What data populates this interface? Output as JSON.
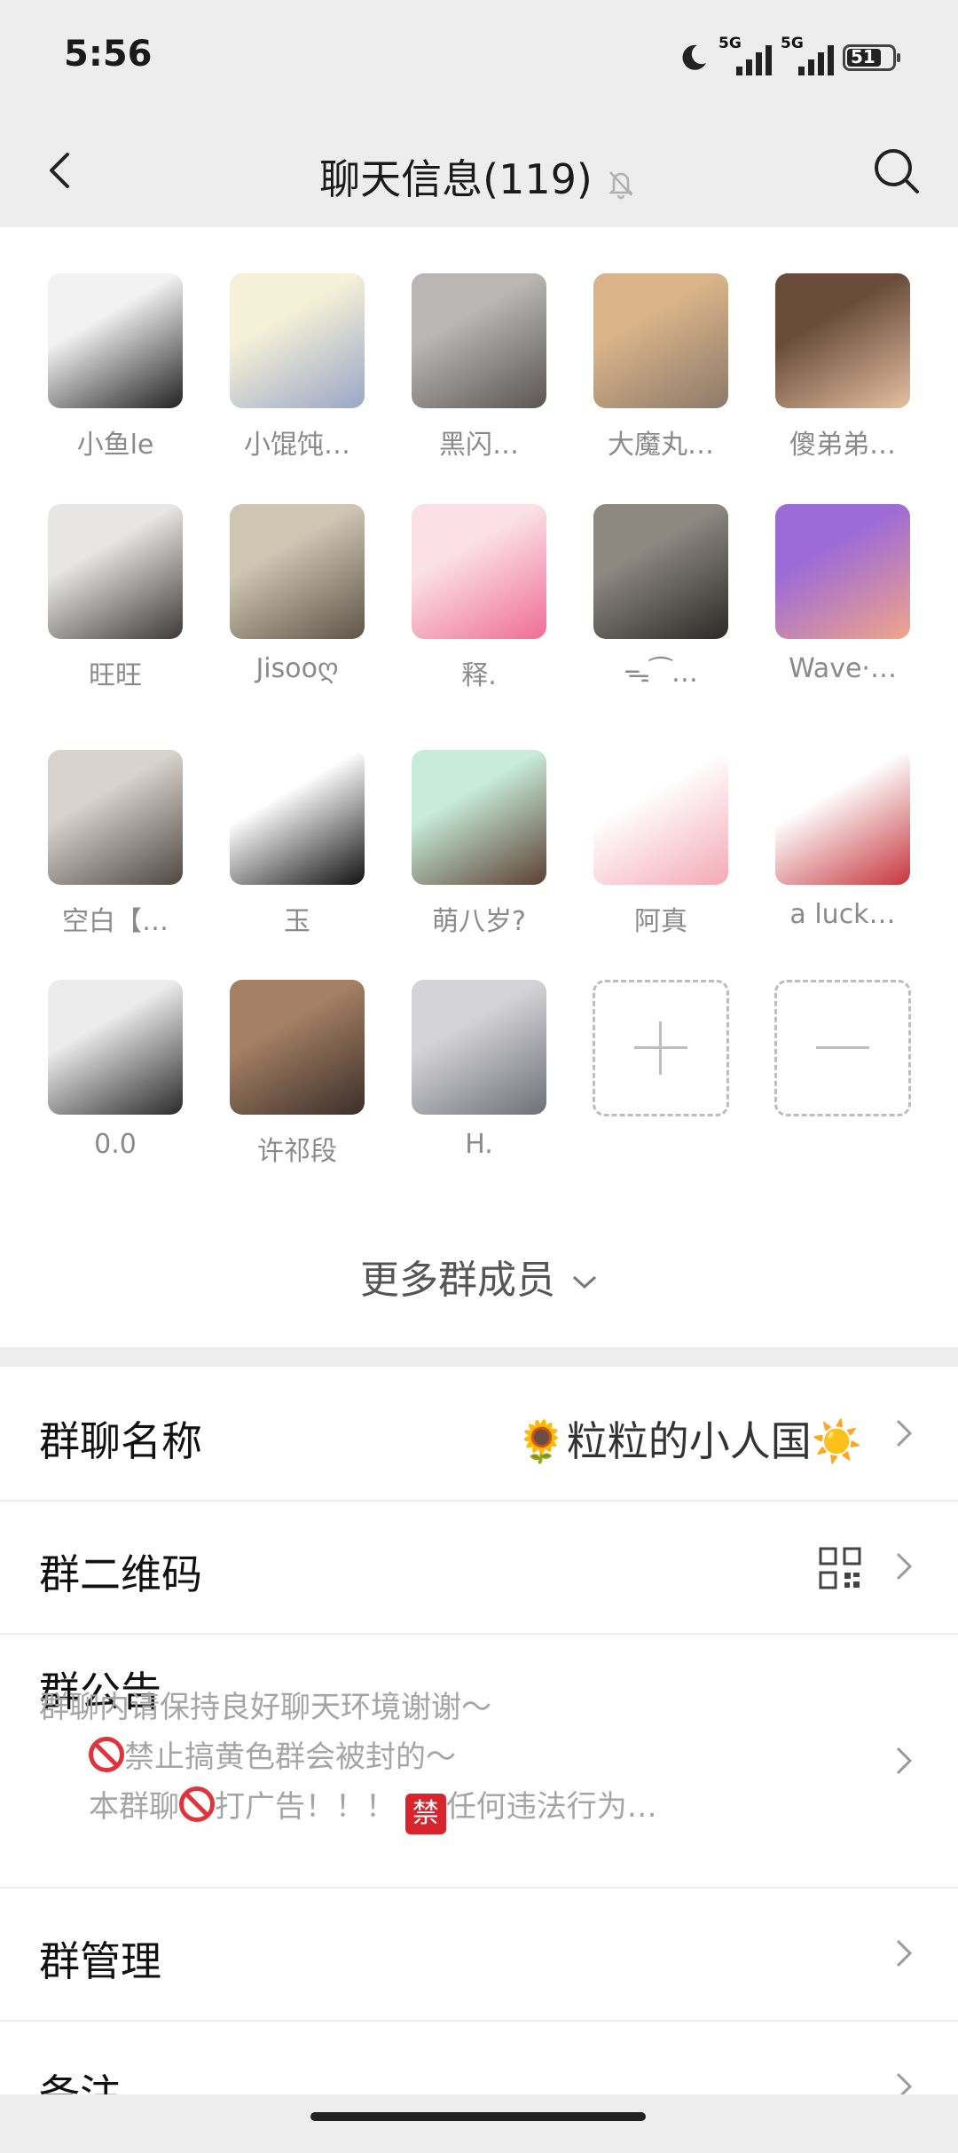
{
  "status_bar": {
    "time": "5:56",
    "network1": "5G",
    "network2": "5G",
    "battery": "51"
  },
  "nav": {
    "title": "聊天信息(119)"
  },
  "members": [
    {
      "name": "小鱼le",
      "color1": "#f2f2f2",
      "color2": "#222222"
    },
    {
      "name": "小馄饨…",
      "color1": "#f5f0d8",
      "color2": "#9aa7c7"
    },
    {
      "name": "黑闪…",
      "color1": "#b9b6b3",
      "color2": "#5a5552"
    },
    {
      "name": "大魔丸…",
      "color1": "#d9b48a",
      "color2": "#8c7a6a"
    },
    {
      "name": "傻弟弟…",
      "color1": "#6b4c3b",
      "color2": "#e3c1a0"
    },
    {
      "name": "旺旺",
      "color1": "#e8e6e4",
      "color2": "#3d3a38"
    },
    {
      "name": "Jisooღ",
      "color1": "#cfc5b3",
      "color2": "#5e5547"
    },
    {
      "name": "释.",
      "color1": "#fbe0e8",
      "color2": "#f06d95"
    },
    {
      "name": "ᯓ⁀…",
      "color1": "#8d8880",
      "color2": "#2c2a27"
    },
    {
      "name": "Wave·…",
      "color1": "#9d6bd6",
      "color2": "#f2a58a"
    },
    {
      "name": "空白【…",
      "color1": "#d9d3cd",
      "color2": "#4f4742"
    },
    {
      "name": "玉",
      "color1": "#ffffff",
      "color2": "#111111"
    },
    {
      "name": "萌八岁?",
      "color1": "#c8ecd8",
      "color2": "#5b3f33"
    },
    {
      "name": "阿真",
      "color1": "#ffffff",
      "color2": "#f4a9b4"
    },
    {
      "name": "a luck…",
      "color1": "#ffffff",
      "color2": "#c6353c"
    },
    {
      "name": "0.0",
      "color1": "#ececec",
      "color2": "#2a2a2a"
    },
    {
      "name": "许祁段",
      "color1": "#a58064",
      "color2": "#3b2f29"
    },
    {
      "name": "H.",
      "color1": "#d4d4d8",
      "color2": "#6f7078"
    }
  ],
  "more_members": "更多群成员",
  "settings": {
    "group_name_label": "群聊名称",
    "group_name_value": "🌻粒粒的小人国☀️",
    "qr_label": "群二维码",
    "notice_label": "群公告",
    "notice_line1": "群聊内请保持良好聊天环境谢谢～",
    "notice_line2": "禁止搞黄色群会被封的～",
    "notice_line3a": "本群聊",
    "notice_line3b": "打广告！！！",
    "notice_line3c": "禁",
    "notice_line3d": "任何违法行为…",
    "manage_label": "群管理",
    "remark_label": "备注"
  }
}
